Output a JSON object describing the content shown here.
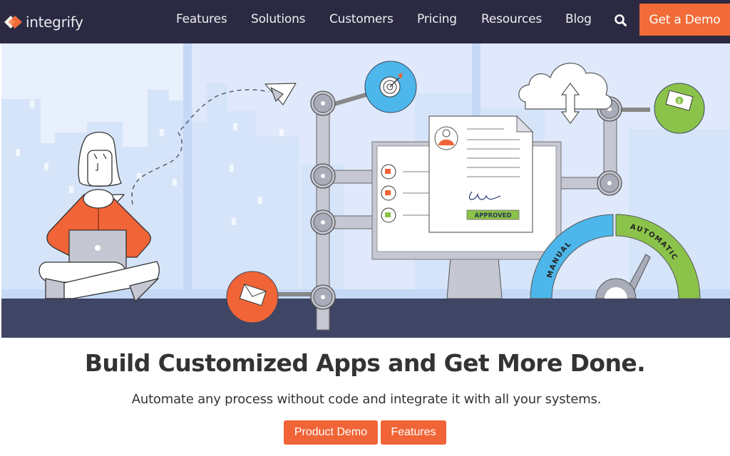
{
  "brand": {
    "name": "integrify",
    "logo_icon": "diamond-logo-icon",
    "colors": {
      "nav_bg": "#2b2a42",
      "accent": "#f26b38",
      "hero_bg": "#dde8fb",
      "floor": "#3f4564",
      "blue": "#4db6ea",
      "green": "#8bc34a"
    }
  },
  "nav": {
    "items": [
      {
        "label": "Features"
      },
      {
        "label": "Solutions"
      },
      {
        "label": "Customers"
      },
      {
        "label": "Pricing"
      },
      {
        "label": "Resources"
      },
      {
        "label": "Blog"
      }
    ],
    "search_icon": "search-icon",
    "cta_label": "Get a Demo"
  },
  "hero": {
    "illustration": {
      "approved_stamp": "APPROVED",
      "gauge_left_label": "MANUAL",
      "gauge_right_label": "AUTOMATIC",
      "money_symbol": "$",
      "icons": [
        "paper-plane-icon",
        "target-icon",
        "cloud-sync-icon",
        "money-icon",
        "envelope-icon",
        "checklist-icon",
        "document-icon",
        "gauge-icon",
        "person-with-laptop"
      ]
    }
  },
  "main": {
    "headline": "Build Customized Apps and Get More Done.",
    "subheadline": "Automate any process without code and integrate it with all your systems.",
    "buttons": [
      {
        "label": "Product Demo"
      },
      {
        "label": "Features"
      }
    ]
  }
}
